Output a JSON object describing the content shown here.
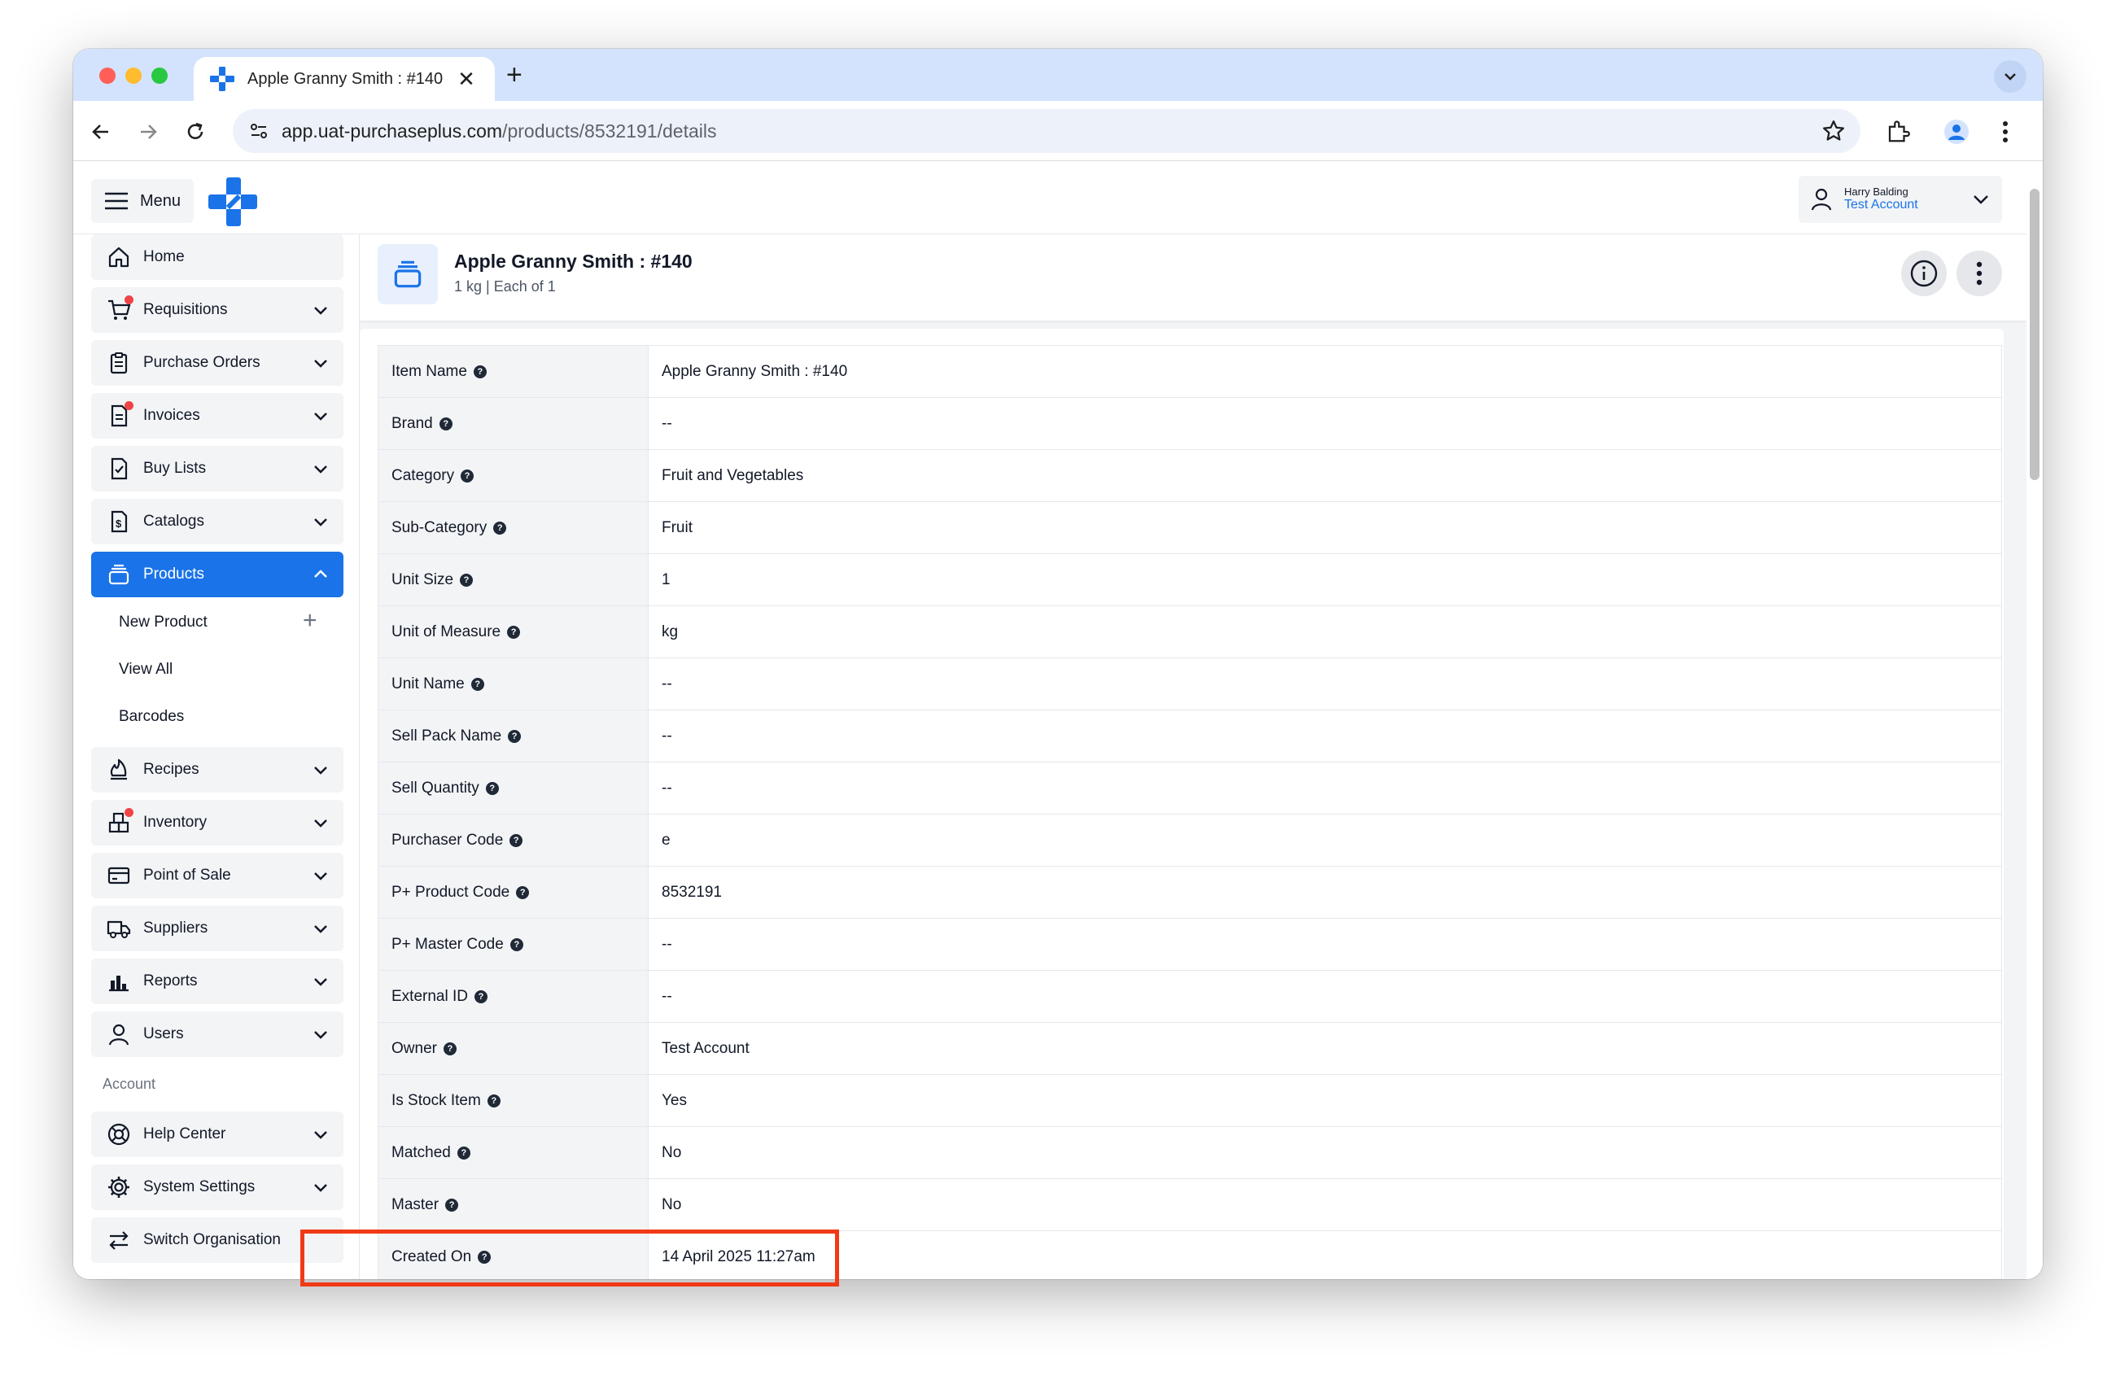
{
  "browser": {
    "tab_title": "Apple Granny Smith : #140",
    "close_glyph": "✕",
    "new_tab_glyph": "+",
    "url_host": "app.uat-purchaseplus.com",
    "url_path": "/products/8532191/details"
  },
  "header": {
    "menu_label": "Menu",
    "user_name": "Harry Balding",
    "user_account": "Test Account"
  },
  "sidebar": {
    "items": [
      {
        "label": "Home",
        "icon": "home-icon"
      },
      {
        "label": "Requisitions",
        "icon": "cart-icon",
        "notification": true
      },
      {
        "label": "Purchase Orders",
        "icon": "clipboard-icon"
      },
      {
        "label": "Invoices",
        "icon": "invoice-icon",
        "notification": true
      },
      {
        "label": "Buy Lists",
        "icon": "checklist-icon"
      },
      {
        "label": "Catalogs",
        "icon": "dollar-doc-icon"
      },
      {
        "label": "Products",
        "icon": "products-icon",
        "active": true
      },
      {
        "label": "Recipes",
        "icon": "flame-icon"
      },
      {
        "label": "Inventory",
        "icon": "boxes-icon",
        "notification": true
      },
      {
        "label": "Point of Sale",
        "icon": "card-icon"
      },
      {
        "label": "Suppliers",
        "icon": "truck-icon"
      },
      {
        "label": "Reports",
        "icon": "chart-icon"
      },
      {
        "label": "Users",
        "icon": "user-icon"
      }
    ],
    "products_sub": [
      "New Product",
      "View All",
      "Barcodes"
    ],
    "account_section": "Account",
    "account_items": [
      {
        "label": "Help Center",
        "icon": "lifebuoy-icon"
      },
      {
        "label": "System Settings",
        "icon": "gear-icon"
      },
      {
        "label": "Switch Organisation",
        "icon": "switch-icon"
      }
    ]
  },
  "product": {
    "title": "Apple Granny Smith : #140",
    "subtitle": "1 kg | Each of 1"
  },
  "details": [
    {
      "label": "Item Name",
      "value": "Apple Granny Smith : #140"
    },
    {
      "label": "Brand",
      "value": "--"
    },
    {
      "label": "Category",
      "value": "Fruit and Vegetables"
    },
    {
      "label": "Sub-Category",
      "value": "Fruit"
    },
    {
      "label": "Unit Size",
      "value": "1"
    },
    {
      "label": "Unit of Measure",
      "value": "kg"
    },
    {
      "label": "Unit Name",
      "value": "--"
    },
    {
      "label": "Sell Pack Name",
      "value": "--"
    },
    {
      "label": "Sell Quantity",
      "value": "--"
    },
    {
      "label": "Purchaser Code",
      "value": "e"
    },
    {
      "label": "P+ Product Code",
      "value": "8532191"
    },
    {
      "label": "P+ Master Code",
      "value": "--"
    },
    {
      "label": "External ID",
      "value": "--"
    },
    {
      "label": "Owner",
      "value": "Test Account"
    },
    {
      "label": "Is Stock Item",
      "value": "Yes"
    },
    {
      "label": "Matched",
      "value": "No"
    },
    {
      "label": "Master",
      "value": "No"
    },
    {
      "label": "Created On",
      "value": "14 April 2025 11:27am"
    }
  ],
  "colors": {
    "accent": "#1a73e8",
    "highlight": "#f03a17",
    "notification": "#ef4444"
  }
}
